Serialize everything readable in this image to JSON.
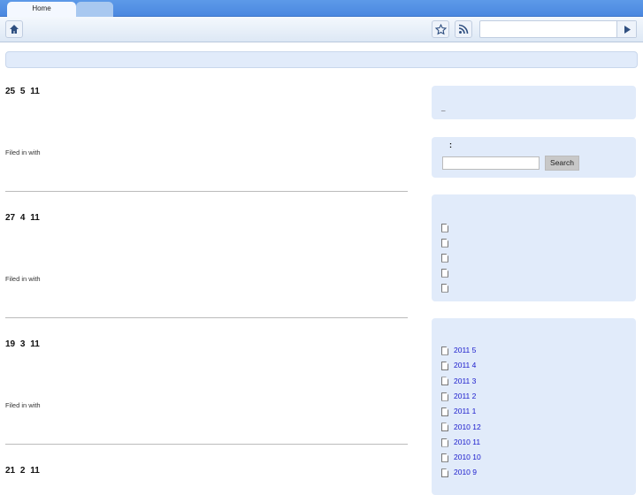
{
  "browser": {
    "tabs": [
      {
        "label": "Home"
      },
      {
        "label": ""
      }
    ]
  },
  "posts": [
    {
      "title": "25 5 11",
      "filed": "Filed in with"
    },
    {
      "title": "27 4 11",
      "filed": "Filed in with"
    },
    {
      "title": "19 3 11",
      "filed": "Filed in with"
    },
    {
      "title": "21 2 11"
    }
  ],
  "sidebar": {
    "box1": {
      "text": "_"
    },
    "search": {
      "label": ":",
      "button": "Search",
      "value": ""
    },
    "pages": [
      "",
      "",
      "",
      "",
      ""
    ],
    "archives": [
      "2011 5",
      "2011 4",
      "2011 3",
      "2011 2",
      "2011 1",
      "2010 12",
      "2010 11",
      "2010 10",
      "2010 9"
    ]
  }
}
